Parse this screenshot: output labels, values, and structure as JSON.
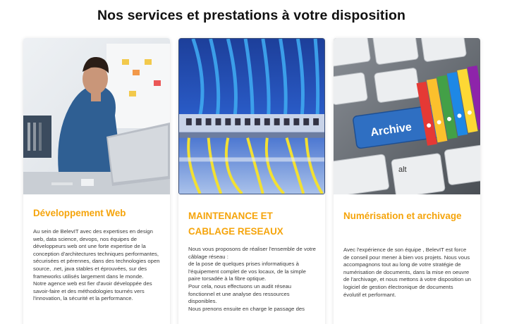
{
  "page": {
    "title": "Nos services et prestations à votre disposition"
  },
  "cards": [
    {
      "image": "developer-laptop-photo",
      "title": "Développement Web",
      "paragraphs": [
        "Au sein de BelevIT avec des expertises en design web, data science, devops, nos équipes de développeurs web ont une forte expertise de la conception d'architectures techniques performantes, sécurisées et pérennes, dans des technologies open source, .net, java stables et éprouvées, sur des frameworks utilisés largement dans le monde.",
        "Notre agence web est fier d'avoir développée des savoir-faire et des méthodologies tournés vers l'innovation, la sécurité et la performance."
      ]
    },
    {
      "image": "network-cables-photo",
      "title": "MAINTENANCE ET CABLAGE RESEAUX",
      "paragraphs": [
        "Nous vous proposons de réaliser l'ensemble de votre câblage réseau :",
        "de la pose de quelques prises informatiques à l'équipement complet de vos locaux, de la simple paire torsadée à la fibre optique.",
        "Pour cela, nous effectuons un audit réseau fonctionnel et une analyse des ressources disponibles.",
        "Nous prenons ensuite en charge le passage des"
      ]
    },
    {
      "image": "archive-keyboard-photo",
      "key_label": "Archive",
      "key_alt": "alt",
      "title": "Numérisation et archivage",
      "paragraphs": [
        "Avec l'expérience de son équipe , BelevIT est force de conseil pour mener à bien vos projets. Nous vous accompagnons tout au long de votre stratégie de numérisation de documents, dans la mise en oeuvre de l'archivage, et nous mettons à votre disposition un logiciel de gestion électronique de documents évolutif et performant."
      ]
    }
  ]
}
